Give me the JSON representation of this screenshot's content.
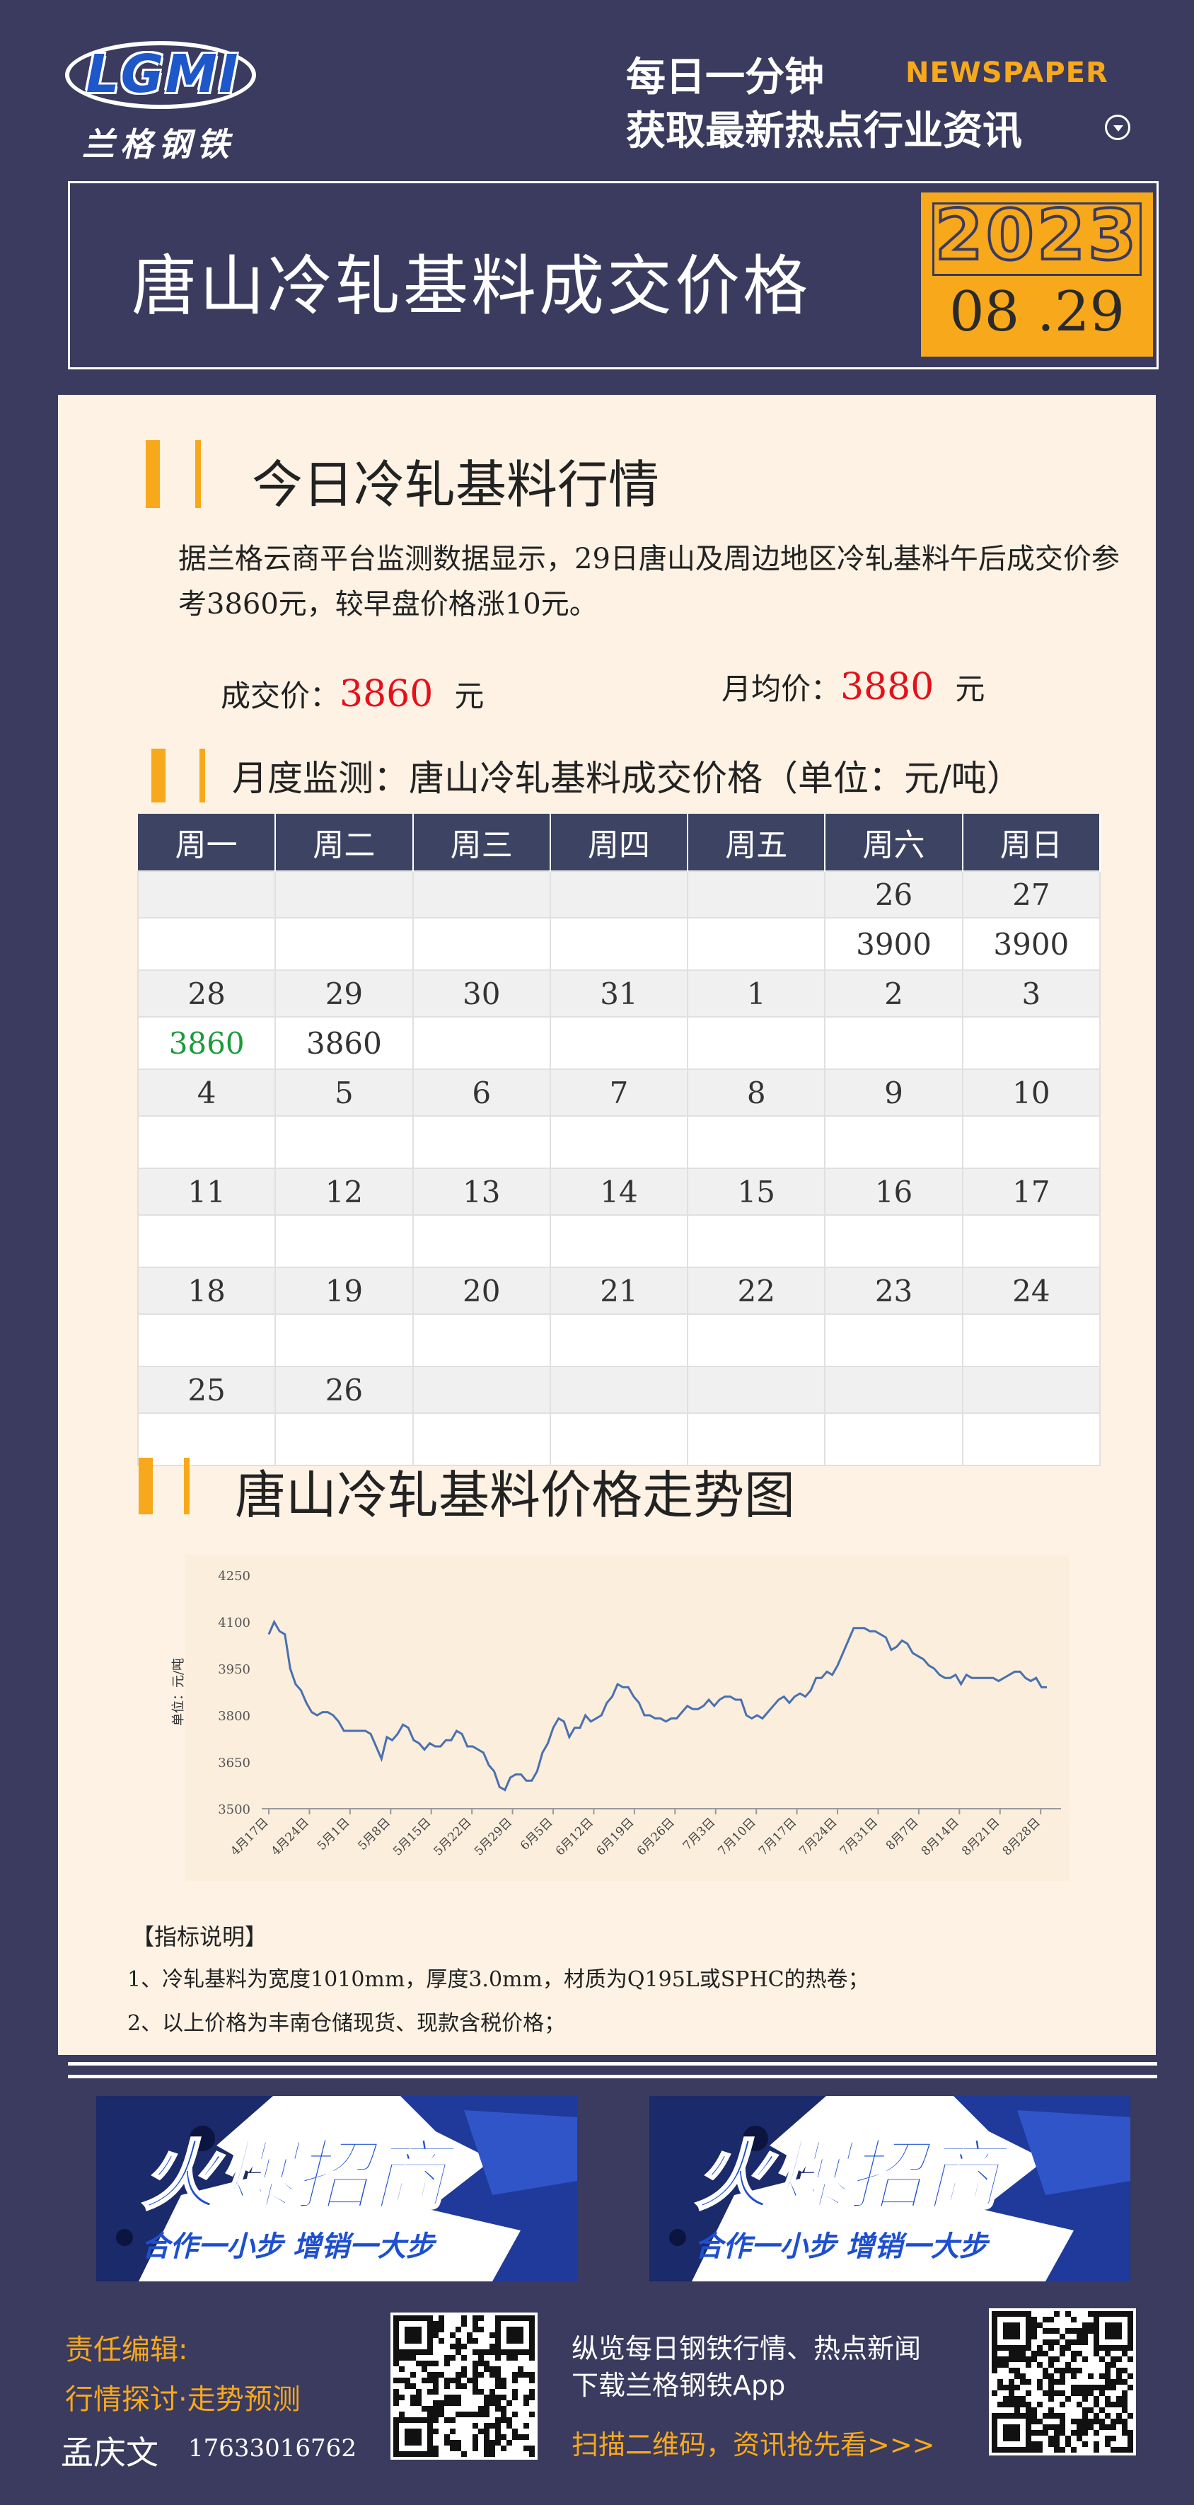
{
  "header": {
    "logo_text": "LGMI",
    "logo_cn": "兰格钢铁",
    "slogan1": "每日一分钟",
    "newspaper": "NEWSPAPER",
    "slogan2": "获取最新热点行业资讯",
    "title": "唐山冷轧基料成交价格",
    "year": "2023",
    "date": "08 .29"
  },
  "section1": {
    "title": "今日冷轧基料行情",
    "paragraph": "据兰格云商平台监测数据显示，29日唐山及周边地区冷轧基料午后成交价参考3860元，较早盘价格涨10元。",
    "deal_label": "成交价：",
    "deal_value": "3860",
    "deal_unit": "元",
    "avg_label": "月均价：",
    "avg_value": "3880",
    "avg_unit": "元"
  },
  "section2": {
    "title": "月度监测：唐山冷轧基料成交价格（单位：元/吨）",
    "weekdays": [
      "周一",
      "周二",
      "周三",
      "周四",
      "周五",
      "周六",
      "周日"
    ],
    "rows": [
      {
        "days": [
          "",
          "",
          "",
          "",
          "",
          "26",
          "27"
        ],
        "values": [
          "",
          "",
          "",
          "",
          "",
          "3900",
          "3900"
        ]
      },
      {
        "days": [
          "28",
          "29",
          "30",
          "31",
          "1",
          "2",
          "3"
        ],
        "values": [
          "3860",
          "3860",
          "",
          "",
          "",
          "",
          ""
        ]
      },
      {
        "days": [
          "4",
          "5",
          "6",
          "7",
          "8",
          "9",
          "10"
        ],
        "values": [
          "",
          "",
          "",
          "",
          "",
          "",
          ""
        ]
      },
      {
        "days": [
          "11",
          "12",
          "13",
          "14",
          "15",
          "16",
          "17"
        ],
        "values": [
          "",
          "",
          "",
          "",
          "",
          "",
          ""
        ]
      },
      {
        "days": [
          "18",
          "19",
          "20",
          "21",
          "22",
          "23",
          "24"
        ],
        "values": [
          "",
          "",
          "",
          "",
          "",
          "",
          ""
        ]
      },
      {
        "days": [
          "25",
          "26",
          "",
          "",
          "",
          "",
          ""
        ],
        "values": [
          "",
          "",
          "",
          "",
          "",
          "",
          ""
        ]
      }
    ]
  },
  "section3": {
    "title": "唐山冷轧基料价格走势图"
  },
  "chart_data": {
    "type": "line",
    "ylabel": "单位：元/吨",
    "ylim": [
      3500,
      4250
    ],
    "yticks": [
      3500,
      3650,
      3800,
      3950,
      4100,
      4250
    ],
    "xticks": [
      "4月17日",
      "4月24日",
      "5月1日",
      "5月8日",
      "5月15日",
      "5月22日",
      "5月29日",
      "6月5日",
      "6月12日",
      "6月19日",
      "6月26日",
      "7月3日",
      "7月10日",
      "7月17日",
      "7月24日",
      "7月31日",
      "8月7日",
      "8月14日",
      "8月21日",
      "8月28日"
    ],
    "color": "#4a70b0",
    "grid": false,
    "values": [
      4060,
      4100,
      4070,
      4060,
      3950,
      3900,
      3880,
      3840,
      3810,
      3800,
      3810,
      3810,
      3800,
      3780,
      3750,
      3750,
      3750,
      3750,
      3750,
      3740,
      3700,
      3660,
      3730,
      3720,
      3740,
      3770,
      3760,
      3720,
      3710,
      3690,
      3710,
      3700,
      3700,
      3720,
      3720,
      3750,
      3740,
      3700,
      3700,
      3690,
      3680,
      3640,
      3620,
      3570,
      3560,
      3600,
      3610,
      3610,
      3590,
      3590,
      3620,
      3680,
      3710,
      3760,
      3790,
      3780,
      3730,
      3760,
      3760,
      3800,
      3780,
      3790,
      3800,
      3840,
      3860,
      3900,
      3890,
      3890,
      3860,
      3840,
      3800,
      3800,
      3790,
      3790,
      3780,
      3790,
      3790,
      3810,
      3830,
      3820,
      3820,
      3830,
      3850,
      3830,
      3850,
      3860,
      3860,
      3850,
      3850,
      3800,
      3790,
      3800,
      3790,
      3810,
      3830,
      3850,
      3860,
      3840,
      3860,
      3870,
      3860,
      3880,
      3920,
      3920,
      3940,
      3930,
      3960,
      4000,
      4040,
      4080,
      4080,
      4080,
      4070,
      4070,
      4060,
      4050,
      4010,
      4020,
      4040,
      4030,
      4000,
      3990,
      3980,
      3960,
      3950,
      3930,
      3920,
      3920,
      3930,
      3900,
      3930,
      3920,
      3920,
      3920,
      3920,
      3920,
      3910,
      3920,
      3930,
      3940,
      3940,
      3920,
      3910,
      3920,
      3890,
      3890
    ]
  },
  "notes": {
    "title": "【指标说明】",
    "items": [
      "1、冷轧基料为宽度1010mm，厚度3.0mm，材质为Q195L或SPHC的热卷；",
      "2、以上价格为丰南仓储现货、现款含税价格；"
    ]
  },
  "ads": {
    "headline": "火爆招商",
    "subline": "合作一小步  增销一大步"
  },
  "footer": {
    "editor_label": "责任编辑:",
    "editor_sub": "行情探讨·走势预测",
    "editor_name": "孟庆文",
    "editor_phone": "17633016762",
    "promo1": "纵览每日钢铁行情、热点新闻",
    "promo2": "下载兰格钢铁App",
    "promo3": "扫描二维码，资讯抢先看>>>"
  },
  "colors": {
    "background": "#3a3b5e",
    "accent": "#f7a81b",
    "panel": "#fdf2e4",
    "price_red": "#e4101b",
    "table_header": "#3d4463",
    "green_value": "#1d9a3a"
  }
}
